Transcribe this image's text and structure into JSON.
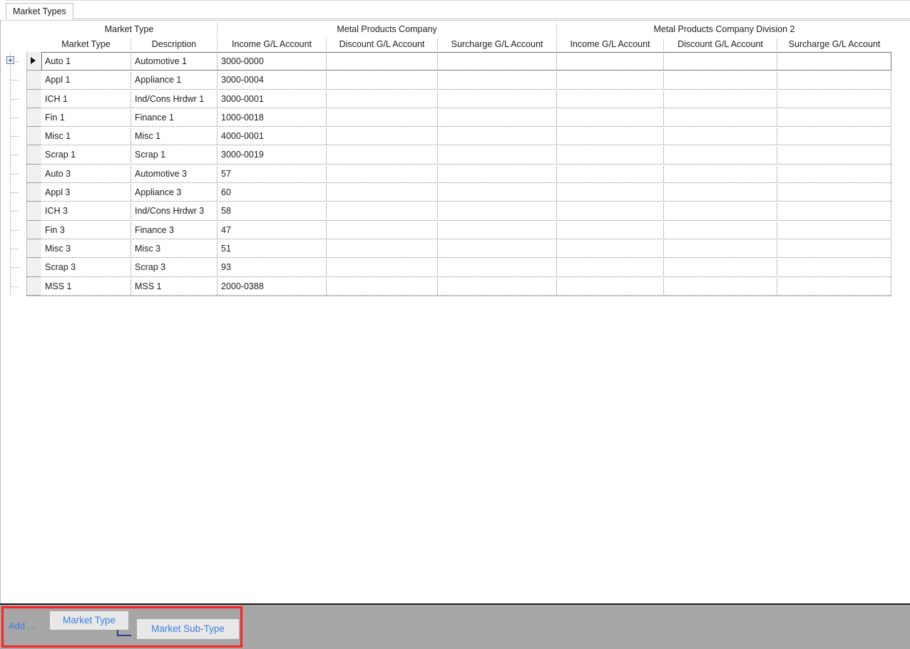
{
  "window": {
    "accent_color": "#3a7fe0",
    "highlight_color": "#ff2020",
    "panel_color": "#a6a6a6"
  },
  "tabs": [
    {
      "label": "Market Types",
      "active": true
    }
  ],
  "grid": {
    "group_headers": [
      {
        "label": "Market Type"
      },
      {
        "label": "Metal Products Company"
      },
      {
        "label": "Metal Products Company Division 2"
      }
    ],
    "columns": [
      {
        "label": "Market Type"
      },
      {
        "label": "Description"
      },
      {
        "label": "Income G/L Account"
      },
      {
        "label": "Discount G/L Account"
      },
      {
        "label": "Surcharge G/L Account"
      },
      {
        "label": "Income G/L Account"
      },
      {
        "label": "Discount G/L Account"
      },
      {
        "label": "Surcharge G/L Account"
      }
    ],
    "rows": [
      {
        "market_type": "Auto 1",
        "description": "Automotive 1",
        "income_gl": "3000-0000",
        "discount_gl": "",
        "surcharge_gl": "",
        "income_gl_2": "",
        "discount_gl_2": "",
        "surcharge_gl_2": "",
        "current": true,
        "expandable": true
      },
      {
        "market_type": "Appl 1",
        "description": "Appliance 1",
        "income_gl": "3000-0004",
        "discount_gl": "",
        "surcharge_gl": "",
        "income_gl_2": "",
        "discount_gl_2": "",
        "surcharge_gl_2": "",
        "current": false,
        "expandable": false
      },
      {
        "market_type": "ICH 1",
        "description": "Ind/Cons Hrdwr 1",
        "income_gl": "3000-0001",
        "discount_gl": "",
        "surcharge_gl": "",
        "income_gl_2": "",
        "discount_gl_2": "",
        "surcharge_gl_2": "",
        "current": false,
        "expandable": false
      },
      {
        "market_type": "Fin 1",
        "description": "Finance 1",
        "income_gl": "1000-0018",
        "discount_gl": "",
        "surcharge_gl": "",
        "income_gl_2": "",
        "discount_gl_2": "",
        "surcharge_gl_2": "",
        "current": false,
        "expandable": false
      },
      {
        "market_type": "Misc 1",
        "description": "Misc 1",
        "income_gl": "4000-0001",
        "discount_gl": "",
        "surcharge_gl": "",
        "income_gl_2": "",
        "discount_gl_2": "",
        "surcharge_gl_2": "",
        "current": false,
        "expandable": false
      },
      {
        "market_type": "Scrap 1",
        "description": "Scrap 1",
        "income_gl": "3000-0019",
        "discount_gl": "",
        "surcharge_gl": "",
        "income_gl_2": "",
        "discount_gl_2": "",
        "surcharge_gl_2": "",
        "current": false,
        "expandable": false
      },
      {
        "market_type": "Auto 3",
        "description": "Automotive 3",
        "income_gl": "57",
        "discount_gl": "",
        "surcharge_gl": "",
        "income_gl_2": "",
        "discount_gl_2": "",
        "surcharge_gl_2": "",
        "current": false,
        "expandable": false
      },
      {
        "market_type": "Appl 3",
        "description": "Appliance 3",
        "income_gl": "60",
        "discount_gl": "",
        "surcharge_gl": "",
        "income_gl_2": "",
        "discount_gl_2": "",
        "surcharge_gl_2": "",
        "current": false,
        "expandable": false
      },
      {
        "market_type": "ICH 3",
        "description": "Ind/Cons Hrdwr 3",
        "income_gl": "58",
        "discount_gl": "",
        "surcharge_gl": "",
        "income_gl_2": "",
        "discount_gl_2": "",
        "surcharge_gl_2": "",
        "current": false,
        "expandable": false
      },
      {
        "market_type": "Fin 3",
        "description": "Finance 3",
        "income_gl": "47",
        "discount_gl": "",
        "surcharge_gl": "",
        "income_gl_2": "",
        "discount_gl_2": "",
        "surcharge_gl_2": "",
        "current": false,
        "expandable": false
      },
      {
        "market_type": "Misc 3",
        "description": "Misc 3",
        "income_gl": "51",
        "discount_gl": "",
        "surcharge_gl": "",
        "income_gl_2": "",
        "discount_gl_2": "",
        "surcharge_gl_2": "",
        "current": false,
        "expandable": false
      },
      {
        "market_type": "Scrap 3",
        "description": "Scrap 3",
        "income_gl": "93",
        "discount_gl": "",
        "surcharge_gl": "",
        "income_gl_2": "",
        "discount_gl_2": "",
        "surcharge_gl_2": "",
        "current": false,
        "expandable": false
      },
      {
        "market_type": "MSS 1",
        "description": "MSS 1",
        "income_gl": "2000-0388",
        "discount_gl": "",
        "surcharge_gl": "",
        "income_gl_2": "",
        "discount_gl_2": "",
        "surcharge_gl_2": "",
        "current": false,
        "expandable": false
      }
    ]
  },
  "bottom_bar": {
    "add_label": "Add ...",
    "buttons": [
      {
        "label": "Market Type"
      },
      {
        "label": "Market Sub-Type"
      }
    ]
  }
}
